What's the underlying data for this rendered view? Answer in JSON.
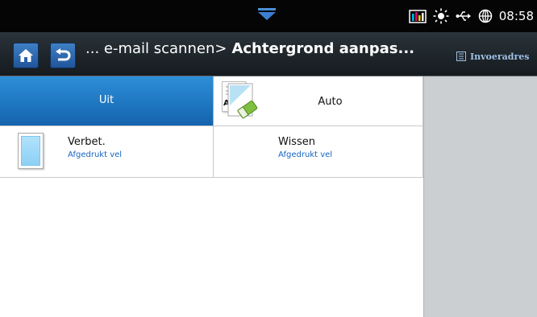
{
  "status_bar": {
    "time": "08:58",
    "icons": [
      "pull-down-handle-icon",
      "toner-levels-icon",
      "brightness-icon",
      "usb-icon",
      "network-globe-icon"
    ]
  },
  "title_bar": {
    "title_prefix": "... e-mail scannen>",
    "title_current": "Achtergrond aanpas...",
    "address_button_label": "Invoeradres",
    "home_icon": "home-icon",
    "back_icon": "back-icon"
  },
  "options": [
    {
      "name": "Uit",
      "selected": true
    },
    {
      "name": "Auto",
      "selected": false,
      "thumb_text": "AUTO"
    },
    {
      "name": "Verbet.",
      "subtitle": "Afgedrukt vel",
      "selected": false
    },
    {
      "name": "Wissen",
      "subtitle": "Afgedrukt vel",
      "selected": false
    }
  ],
  "colors": {
    "selected_option": "#1f7fca",
    "title_bar": "#1f262b",
    "status_bar": "#050505",
    "link_text": "#1565c0",
    "side_panel": "#cbcfd2"
  }
}
